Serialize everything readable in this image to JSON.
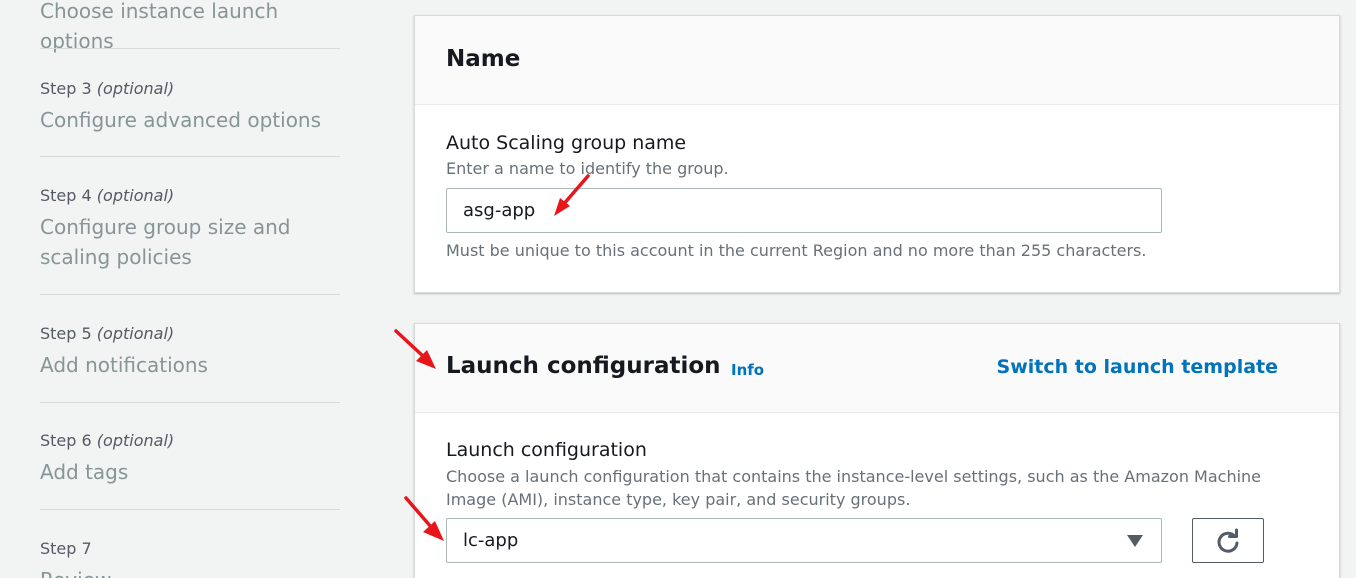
{
  "sidebar": {
    "partial_step_title": "Choose instance launch options",
    "steps": [
      {
        "prefix": "Step 3",
        "optional": "(optional)",
        "title": "Configure advanced options"
      },
      {
        "prefix": "Step 4",
        "optional": "(optional)",
        "title_line1": "Configure group size and",
        "title_line2": "scaling policies"
      },
      {
        "prefix": "Step 5",
        "optional": "(optional)",
        "title": "Add notifications"
      },
      {
        "prefix": "Step 6",
        "optional": "(optional)",
        "title": "Add tags"
      },
      {
        "prefix": "Step 7",
        "title": "Review"
      }
    ]
  },
  "name_section": {
    "title": "Name",
    "field_label": "Auto Scaling group name",
    "field_description": "Enter a name to identify the group.",
    "value": "asg-app",
    "constraint": "Must be unique to this account in the current Region and no more than 255 characters."
  },
  "launch_section": {
    "title": "Launch configuration",
    "info_link": "Info",
    "switch_link": "Switch to launch template",
    "field_label": "Launch configuration",
    "description_line1": "Choose a launch configuration that contains the instance-level settings, such as the Amazon Machine",
    "description_line2": "Image (AMI), instance type, key pair, and security groups.",
    "selected_value": "lc-app"
  },
  "icons": {
    "refresh": "refresh-icon",
    "dropdown": "caret-down-icon",
    "annotation": "red-arrow-icon"
  },
  "colors": {
    "link": "#0073bb",
    "annotation_arrow": "#e8161a",
    "page_background": "#f2f3f3"
  }
}
